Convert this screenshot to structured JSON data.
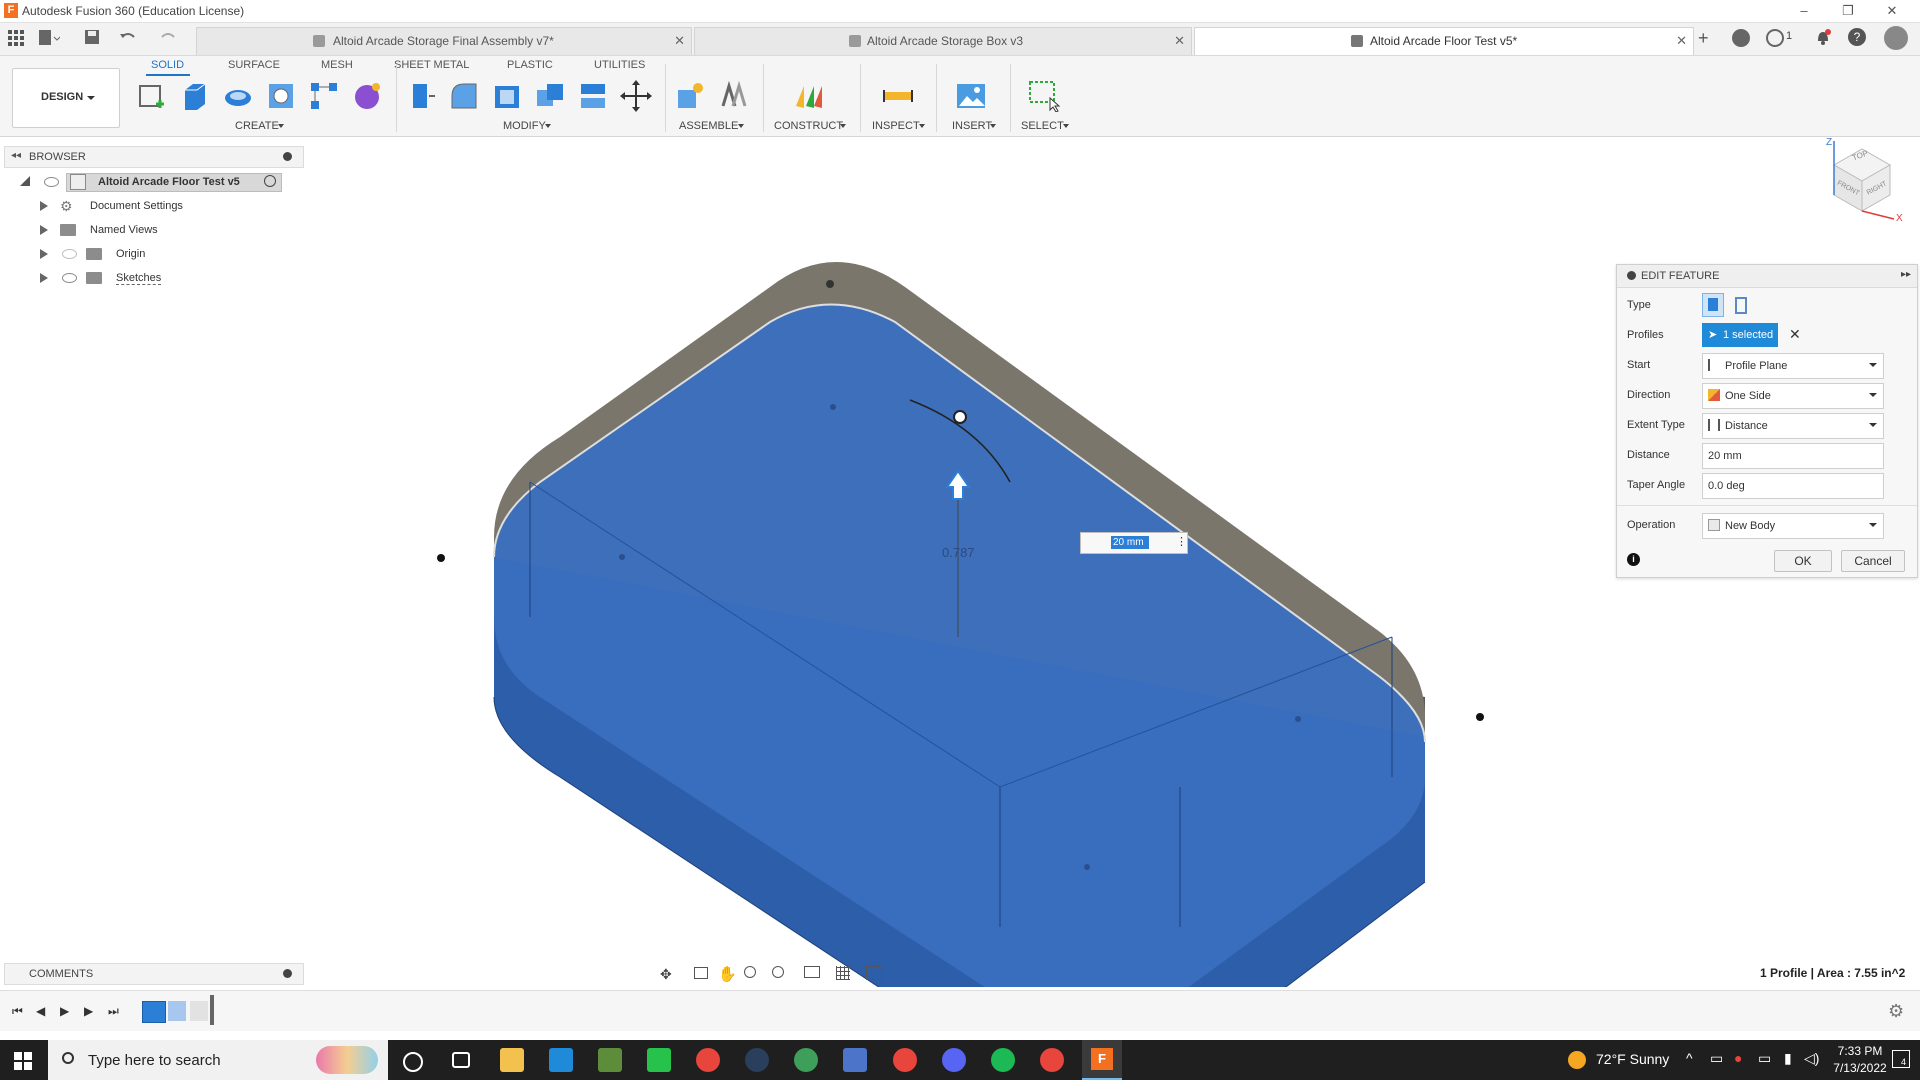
{
  "window": {
    "title": "Autodesk Fusion 360 (Education License)",
    "app_icon_letter": "F"
  },
  "doc_tabs": [
    {
      "label": "Altoid Arcade Storage Final Assembly v7*",
      "active": false
    },
    {
      "label": "Altoid Arcade Storage Box v3",
      "active": false
    },
    {
      "label": "Altoid Arcade Floor Test v5*",
      "active": true
    }
  ],
  "header_right": {
    "jobs_count": "1"
  },
  "ribbon": {
    "tabs": [
      "SOLID",
      "SURFACE",
      "MESH",
      "SHEET METAL",
      "PLASTIC",
      "UTILITIES"
    ],
    "active_tab": "SOLID",
    "workspace": "DESIGN",
    "groups": {
      "create": "CREATE",
      "modify": "MODIFY",
      "assemble": "ASSEMBLE",
      "construct": "CONSTRUCT",
      "inspect": "INSPECT",
      "insert": "INSERT",
      "select": "SELECT"
    }
  },
  "browser": {
    "title": "BROWSER",
    "root": "Altoid Arcade Floor Test v5",
    "items": [
      "Document Settings",
      "Named Views",
      "Origin",
      "Sketches"
    ]
  },
  "viewport": {
    "distance_input": "20 mm",
    "dimension_label": "0.787",
    "viewcube_top": "TOP",
    "viewcube_front": "FRONT",
    "viewcube_right": "RIGHT",
    "axis_z": "Z",
    "axis_x": "X"
  },
  "edit_feature": {
    "title": "EDIT FEATURE",
    "labels": {
      "type": "Type",
      "profiles": "Profiles",
      "start": "Start",
      "direction": "Direction",
      "extent_type": "Extent Type",
      "distance": "Distance",
      "taper_angle": "Taper Angle",
      "operation": "Operation"
    },
    "values": {
      "profiles": "1 selected",
      "start": "Profile Plane",
      "direction": "One Side",
      "extent_type": "Distance",
      "distance": "20 mm",
      "taper_angle": "0.0 deg",
      "operation": "New Body"
    },
    "ok": "OK",
    "cancel": "Cancel"
  },
  "comments": {
    "title": "COMMENTS"
  },
  "status": {
    "text": "1 Profile | Area : 7.55 in^2"
  },
  "taskbar": {
    "search_placeholder": "Type here to search",
    "weather": "72°F  Sunny",
    "time": "7:33 PM",
    "date": "7/13/2022",
    "notification_count": "4"
  },
  "colors": {
    "accent": "#1f73c8",
    "profile_blue": "#2f66b8",
    "body_gray": "#7a766c",
    "taskbar": "#1f1f1f"
  }
}
